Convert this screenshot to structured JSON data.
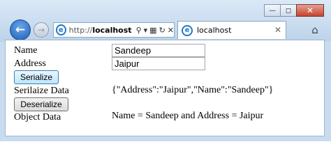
{
  "browser": {
    "url_protocol": "http://",
    "url_host": "localhost",
    "tab_title": "localhost"
  },
  "form": {
    "name_label": "Name",
    "name_value": "Sandeep",
    "address_label": "Address",
    "address_value": "Jaipur",
    "serialize_button": "Serialize",
    "serialized_label": "Serilaize Data",
    "serialized_value": "{\"Address\":\"Jaipur\",\"Name\":\"Sandeep\"}",
    "deserialize_button": "Deserialize",
    "object_label": "Object Data",
    "object_value": "Name = Sandeep and Address = Jaipur"
  }
}
